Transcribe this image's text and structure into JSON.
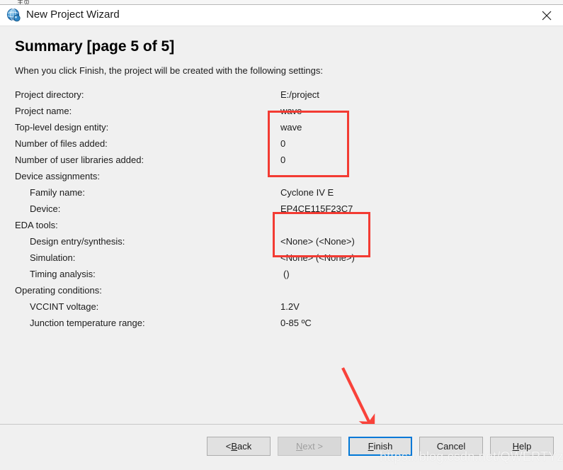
{
  "window": {
    "title": "New Project Wizard",
    "icon": "quartus-globe-icon",
    "close_label": "×"
  },
  "background_window": {
    "tab_text": "主页"
  },
  "page": {
    "title": "Summary [page 5 of 5]",
    "intro": "When you click Finish, the project will be created with the following settings:"
  },
  "summary_rows": [
    {
      "label": "Project directory:",
      "value": "E:/project",
      "indent": false
    },
    {
      "label": "Project name:",
      "value": "wave",
      "indent": false
    },
    {
      "label": "Top-level design entity:",
      "value": "wave",
      "indent": false
    },
    {
      "label": "Number of files added:",
      "value": "0",
      "indent": false
    },
    {
      "label": "Number of user libraries added:",
      "value": "0",
      "indent": false
    },
    {
      "label": "Device assignments:",
      "value": "",
      "indent": false
    },
    {
      "label": "Family name:",
      "value": "Cyclone IV E",
      "indent": true
    },
    {
      "label": "Device:",
      "value": "EP4CE115F23C7",
      "indent": true
    },
    {
      "label": "EDA tools:",
      "value": "",
      "indent": false
    },
    {
      "label": "Design entry/synthesis:",
      "value": "<None> (<None>)",
      "indent": true
    },
    {
      "label": "Simulation:",
      "value": "<None> (<None>)",
      "indent": true
    },
    {
      "label": "Timing analysis:",
      "value": "()",
      "indent": true
    },
    {
      "label": "Operating conditions:",
      "value": "",
      "indent": false
    },
    {
      "label": "VCCINT voltage:",
      "value": "1.2V",
      "indent": true
    },
    {
      "label": "Junction temperature range:",
      "value": "0-85 ºC",
      "indent": true
    }
  ],
  "annotations": {
    "color": "#f33b33",
    "box_project_label": "project-settings-highlight",
    "box_device_label": "device-settings-highlight",
    "arrow_label": "finish-button-arrow"
  },
  "footer": {
    "buttons": [
      {
        "id": "back",
        "label": "< Back",
        "accel": "B",
        "state": "enabled"
      },
      {
        "id": "next",
        "label": "Next >",
        "accel": "N",
        "state": "disabled"
      },
      {
        "id": "finish",
        "label": "Finish",
        "accel": "F",
        "state": "default"
      },
      {
        "id": "cancel",
        "label": "Cancel",
        "accel": "",
        "state": "enabled"
      },
      {
        "id": "help",
        "label": "Help",
        "accel": "H",
        "state": "enabled"
      }
    ]
  },
  "watermark": {
    "text": "https://blog.csdn.net/QWERTYzxw"
  }
}
